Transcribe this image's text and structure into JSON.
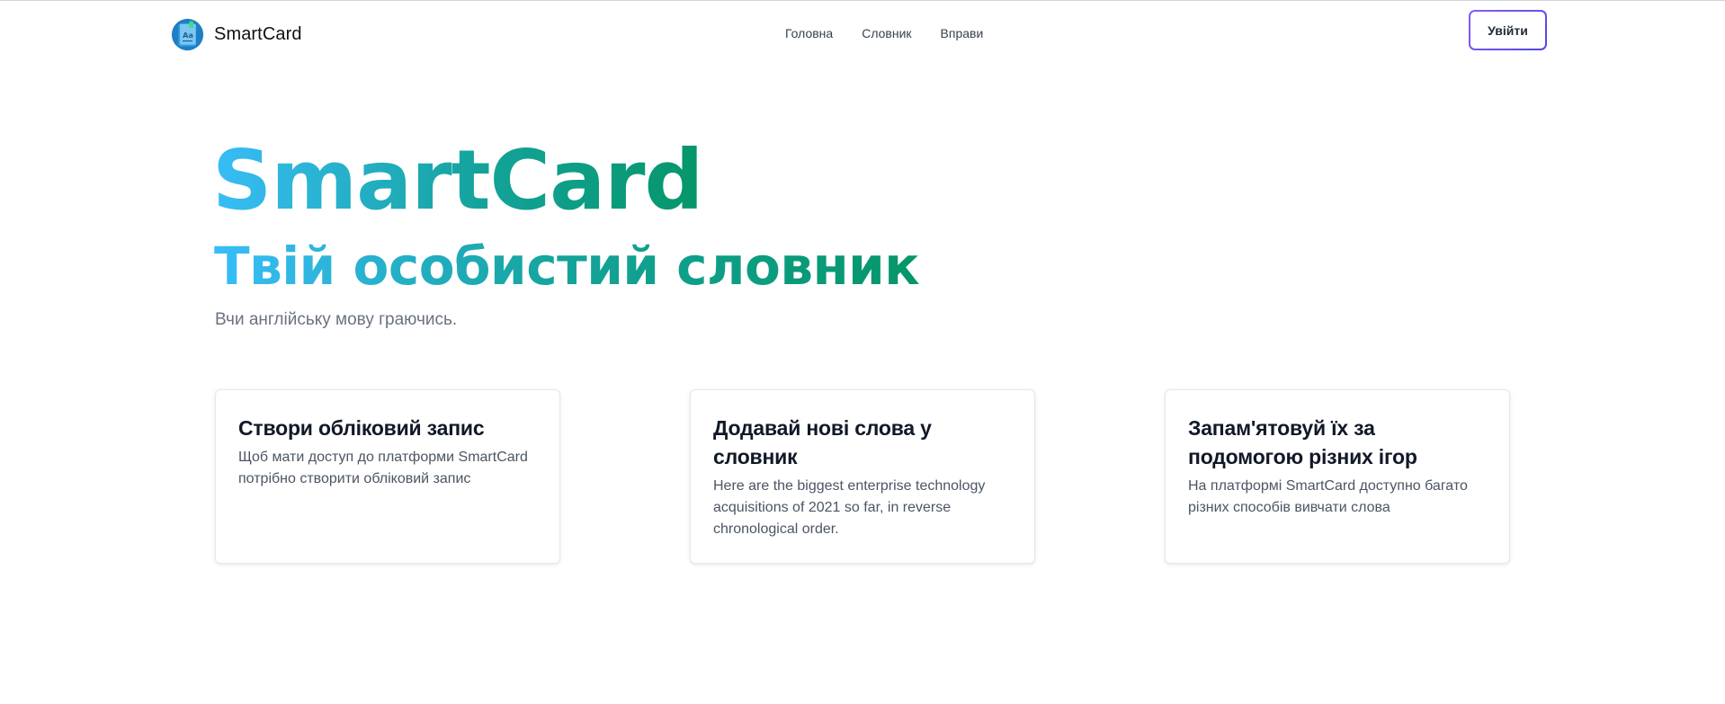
{
  "navbar": {
    "brand_name": "SmartCard",
    "brand_logo_text": "Aa",
    "links": [
      {
        "label": "Головна"
      },
      {
        "label": "Словник"
      },
      {
        "label": "Вправи"
      }
    ],
    "login_label": "Увійти"
  },
  "hero": {
    "title": "SmartCard",
    "subtitle": "Твій особистий словник",
    "tagline": "Вчи англійську мову граючись."
  },
  "cards": [
    {
      "title": "Створи обліковий запис",
      "text": "Щоб мати доступ до платформи SmartCard потрібно створити обліковий запис"
    },
    {
      "title": "Додавай нові слова у словник",
      "text": "Here are the biggest enterprise technology acquisitions of 2021 so far, in reverse chronological order."
    },
    {
      "title": "Запам'ятовуй їх за подомогою різних ігор",
      "text": "На платформі SmartCard доступно багато різних способів вивчати слова"
    }
  ],
  "colors": {
    "gradient_start": "#38bdf8",
    "gradient_end": "#059669",
    "login_border": "#7c3aed"
  }
}
